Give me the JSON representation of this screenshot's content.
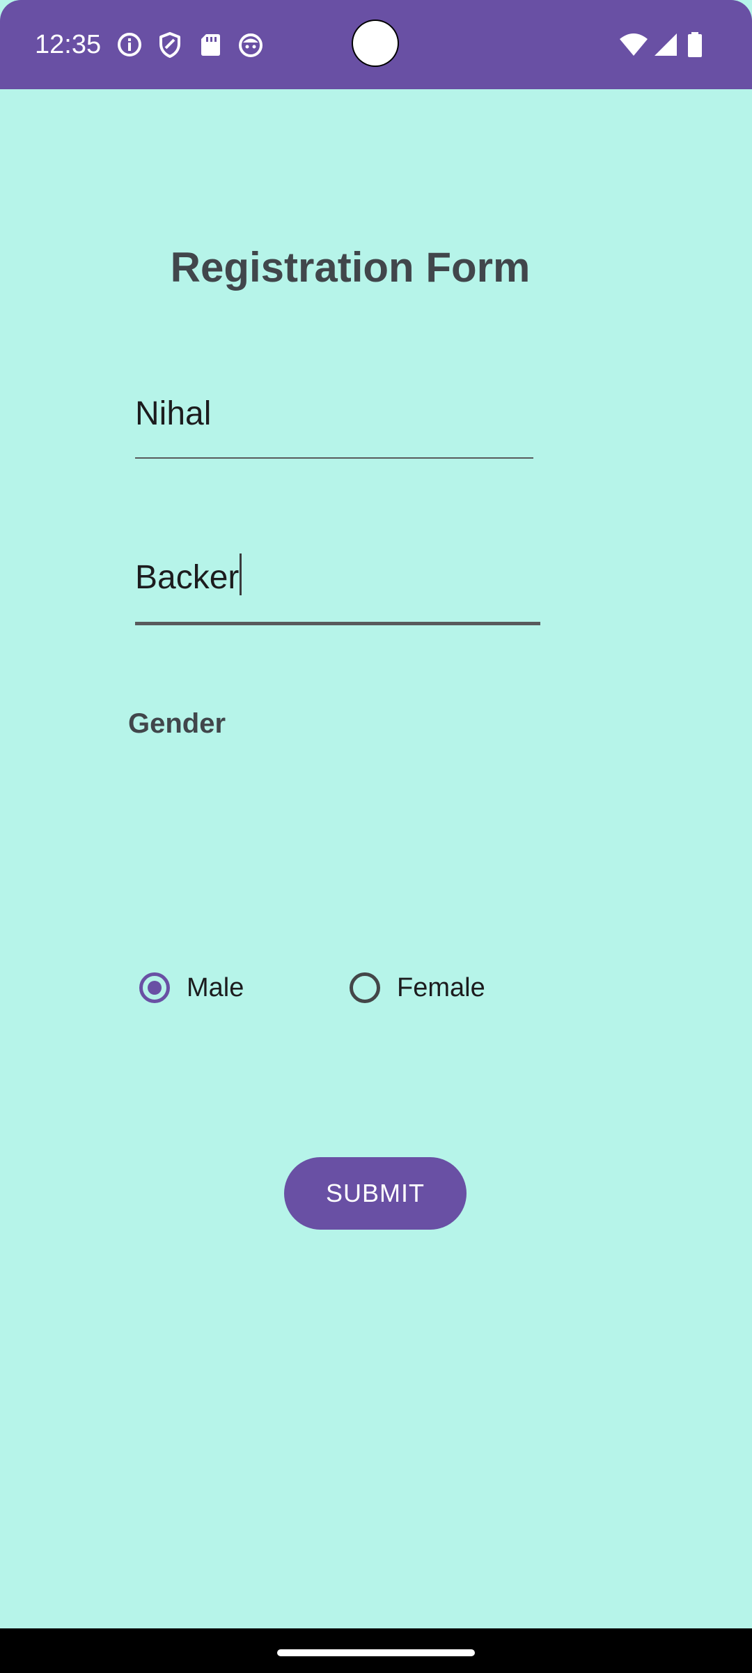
{
  "status_bar": {
    "time": "12:35",
    "left_icons": [
      "info-icon",
      "shield-icon",
      "sd-card-icon",
      "android-face-icon"
    ],
    "right_icons": [
      "wifi-icon",
      "cellular-signal-icon",
      "battery-icon"
    ],
    "background": "#6950a4"
  },
  "form": {
    "title": "Registration Form",
    "first_name_value": "Nihal",
    "last_name_value": "Backer",
    "gender_label": "Gender",
    "gender_options": [
      {
        "label": "Male",
        "checked": true
      },
      {
        "label": "Female",
        "checked": false
      }
    ],
    "submit_label": "SUBMIT"
  },
  "colors": {
    "background": "#b6f4e9",
    "accent": "#6950a4",
    "title_text": "#41464b"
  }
}
